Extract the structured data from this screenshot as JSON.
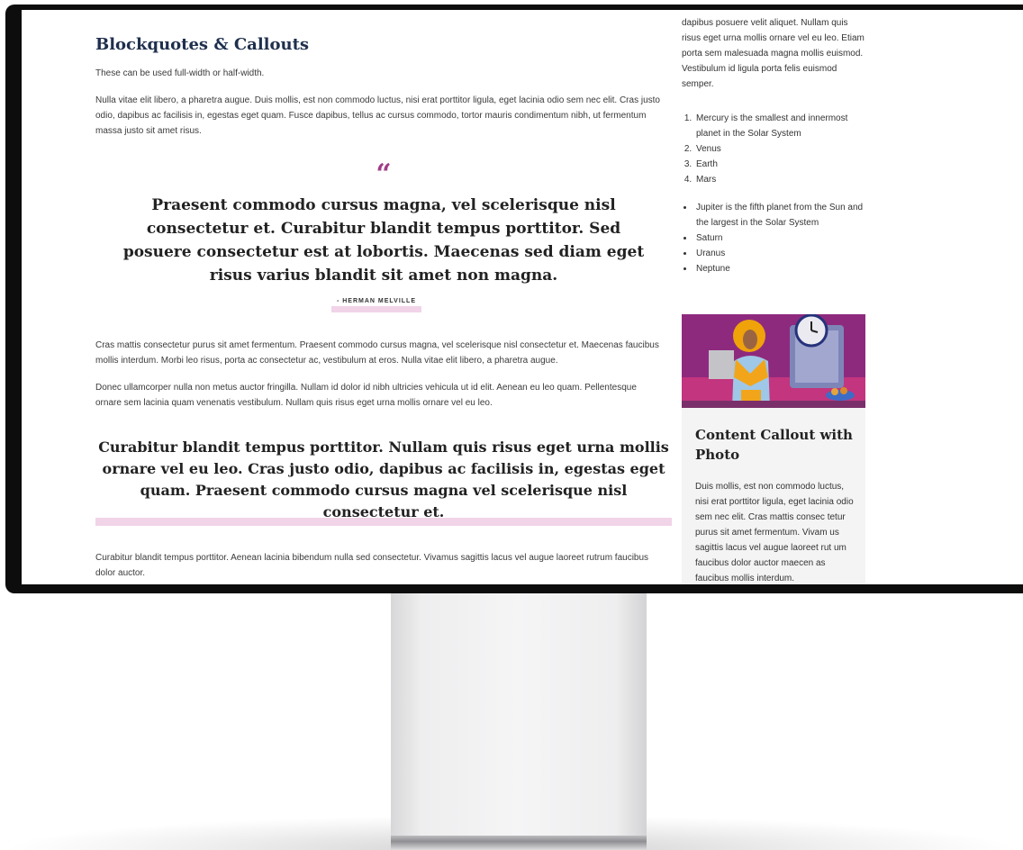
{
  "article": {
    "heading": "Blockquotes & Callouts",
    "intro": "These can be used full-width or half-width.",
    "paragraph1": "Nulla vitae elit libero, a pharetra augue. Duis mollis, est non commodo luctus, nisi erat porttitor ligula, eget lacinia odio sem nec elit. Cras justo odio, dapibus ac facilisis in, egestas eget quam. Fusce dapibus, tellus ac cursus commodo, tortor mauris condimentum nibh, ut fermentum massa justo sit amet risus.",
    "quote_mark": "“",
    "pull_quote": "Praesent commodo cursus magna, vel scelerisque nisl consectetur et. Curabitur blandit tempus porttitor. Sed posuere consectetur est at lobortis. Maecenas sed diam eget risus varius blandit sit amet non magna.",
    "quote_cite": "- HERMAN MELVILLE",
    "paragraph2": "Cras mattis consectetur purus sit amet fermentum. Praesent commodo cursus magna, vel scelerisque nisl consectetur et. Maecenas faucibus mollis interdum. Morbi leo risus, porta ac consectetur ac, vestibulum at eros. Nulla vitae elit libero, a pharetra augue.",
    "paragraph3": "Donec ullamcorper nulla non metus auctor fringilla. Nullam id dolor id nibh ultricies vehicula ut id elit. Aenean eu leo quam. Pellentesque ornare sem lacinia quam venenatis vestibulum. Nullam quis risus eget urna mollis ornare vel eu leo.",
    "callout": "Curabitur blandit tempus porttitor. Nullam quis risus eget urna mollis ornare vel eu leo. Cras justo odio, dapibus ac facilisis in, egestas eget quam. Praesent commodo cursus magna vel scelerisque nisl consectetur et.",
    "paragraph4": "Curabitur blandit tempus porttitor. Aenean lacinia bibendum nulla sed consectetur. Vivamus sagittis lacus vel augue laoreet rutrum faucibus dolor auctor."
  },
  "sidebar": {
    "text": "dapibus posuere velit aliquet. Nullam quis risus eget urna mollis ornare vel eu leo. Etiam porta sem malesuada magna mollis euismod. Vestibulum id ligula porta felis euismod semper.",
    "ordered_list": [
      "Mercury is the smallest and innermost planet in the Solar System",
      "Venus",
      "Earth",
      "Mars"
    ],
    "unordered_list": [
      "Jupiter is the fifth planet from the Sun and the largest in the Solar System",
      "Saturn",
      "Uranus",
      "Neptune"
    ],
    "callout_title": "Content Callout with Photo",
    "callout_text": "Duis mollis, est non commodo luctus, nisi erat porttitor ligula, eget lacinia odio sem nec elit. Cras mattis consec tetur purus sit amet fermentum. Vivam us sagittis lacus vel augue laoreet rut um faucibus dolor auctor maecen as faucibus mollis interdum."
  },
  "colors": {
    "heading": "#1f2f4d",
    "accent": "#a03c84",
    "highlight": "#f1d4e8",
    "card_bg": "#f4f4f5",
    "bezel": "#0d0d0d"
  }
}
